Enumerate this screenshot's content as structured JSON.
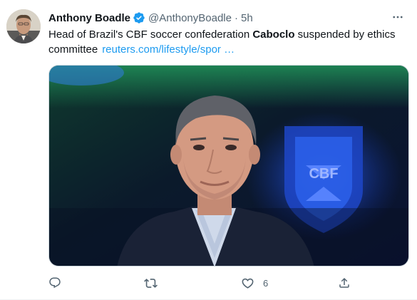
{
  "tweet": {
    "author_name": "Anthony Boadle",
    "handle": "@AnthonyBoadle",
    "separator": "·",
    "time": "5h",
    "text_before": "Head of Brazil's CBF soccer confederation ",
    "text_bold": "Caboclo",
    "text_after": " suspended by ethics committee",
    "link_text": "reuters.com/lifestyle/spor …",
    "media_badge_text": "CBF",
    "like_count": "6"
  },
  "icons": {
    "verified": "verified-badge-icon",
    "more": "more-horizontal-icon",
    "reply": "reply-icon",
    "retweet": "retweet-icon",
    "like": "heart-icon",
    "share": "share-icon"
  },
  "colors": {
    "accent": "#1d9bf0",
    "secondary_text": "#536471",
    "primary_text": "#0f1419"
  }
}
